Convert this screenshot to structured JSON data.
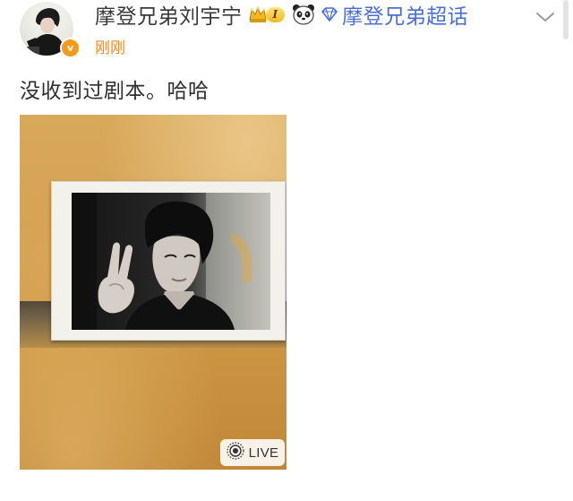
{
  "post": {
    "username": "摩登兄弟刘宇宁",
    "level_badge": "I",
    "supertopic": "摩登兄弟超话",
    "timestamp": "刚刚",
    "text": "没收到过剧本。哈哈",
    "verify_mark": "v",
    "live_label": "LIVE"
  },
  "icons": {
    "crown": "crown-icon",
    "panda": "panda-icon",
    "diamond": "diamond-icon",
    "chevron": "chevron-down-icon",
    "live": "live-photo-icon",
    "verify": "verified-badge-icon"
  },
  "colors": {
    "username": "#3a3a3a",
    "supertopic": "#4a6fd6",
    "timestamp": "#f08a18",
    "verify_badge": "#f59a1b",
    "level_badge": "#f3b921"
  }
}
